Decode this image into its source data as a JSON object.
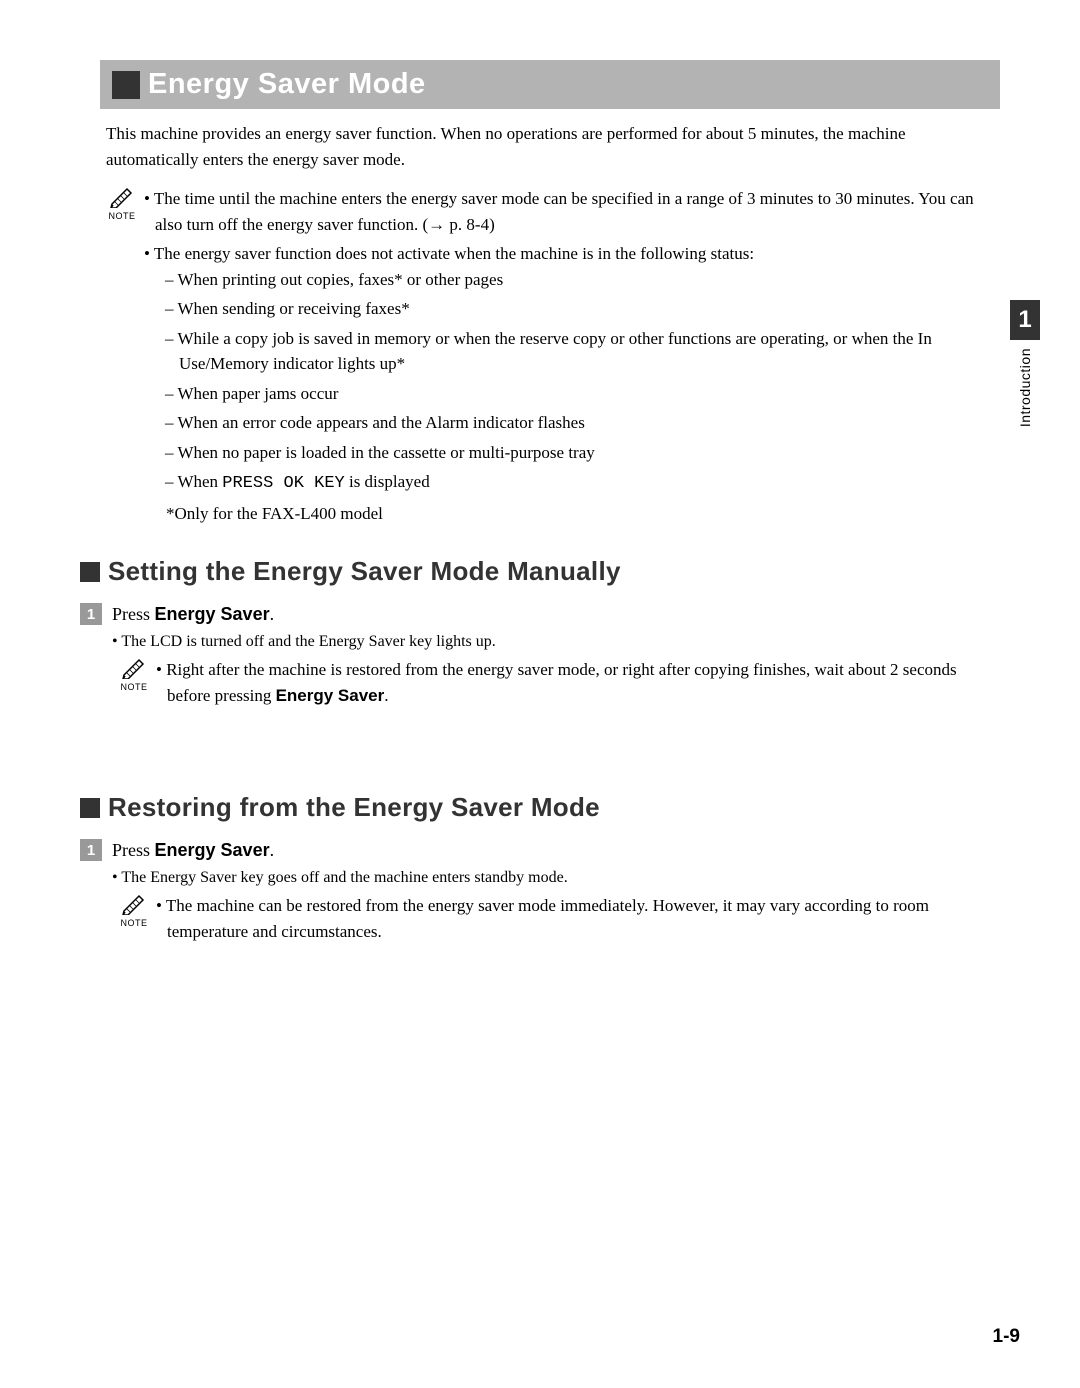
{
  "titleBar": {
    "title": "Energy Saver Mode"
  },
  "intro": "This machine provides an energy saver function. When no operations are performed for about 5 minutes, the machine automatically enters the energy saver mode.",
  "note1": {
    "label": "NOTE",
    "items": [
      {
        "text": "The time until the machine enters the energy saver mode can be specified in a range of 3 minutes to 30 minutes. You can also turn off the energy saver function. (→ p. 8-4)"
      },
      {
        "text": "The energy saver function does not activate when the machine is in the following status:",
        "subitems": [
          "When printing out copies, faxes* or other pages",
          "When sending or receiving faxes*",
          "While a copy job is saved in memory or when the reserve copy or other functions are operating, or when the In Use/Memory indicator lights up*",
          "When paper jams occur",
          "When an error code appears and the Alarm indicator flashes",
          "When no paper is loaded in the cassette or multi-purpose tray"
        ],
        "monoItem": {
          "prefix": "When ",
          "mono": "PRESS OK KEY",
          "suffix": " is displayed"
        },
        "footnote": "*Only for the FAX-L400 model"
      }
    ]
  },
  "section1": {
    "heading": "Setting the Energy Saver Mode Manually",
    "stepNumber": "1",
    "stepPrefix": "Press ",
    "stepBold": "Energy Saver",
    "stepSuffix": ".",
    "bullet": "The LCD is turned off and the Energy Saver key lights up.",
    "note": {
      "label": "NOTE",
      "textPrefix": "Right after the machine is restored from the energy saver mode, or right after copying finishes, wait about 2 seconds before pressing ",
      "bold": "Energy Saver",
      "textSuffix": "."
    }
  },
  "section2": {
    "heading": "Restoring from the Energy Saver Mode",
    "stepNumber": "1",
    "stepPrefix": "Press ",
    "stepBold": "Energy Saver",
    "stepSuffix": ".",
    "bullet": "The Energy Saver key goes off and the machine enters standby mode.",
    "note": {
      "label": "NOTE",
      "text": "The machine can be restored from the energy saver mode immediately. However, it may vary according to room temperature and circumstances."
    }
  },
  "sideTab": {
    "number": "1",
    "label": "Introduction"
  },
  "pageNumber": "1-9"
}
